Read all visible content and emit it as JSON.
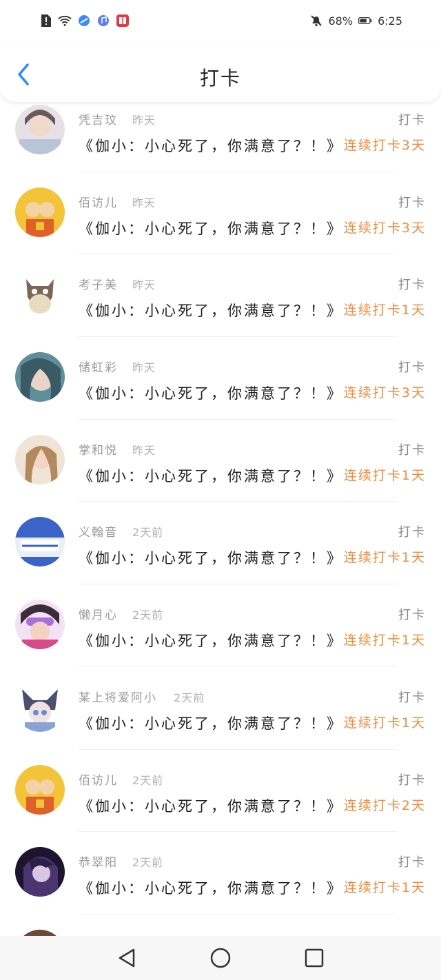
{
  "status_bar": {
    "battery_percent": "68%",
    "time": "6:25"
  },
  "header": {
    "title": "打卡"
  },
  "items": [
    {
      "name": "凭吉玟",
      "time": "昨天",
      "tag": "打卡",
      "quote": "《伽小：小心死了，你满意了？！》",
      "streak": "连续打卡3天",
      "avatar_color": "#d9d2d8"
    },
    {
      "name": "佰访儿",
      "time": "昨天",
      "tag": "打卡",
      "quote": "《伽小：小心死了，你满意了？！》",
      "streak": "连续打卡3天",
      "avatar_color": "#f3c43a"
    },
    {
      "name": "考子美",
      "time": "昨天",
      "tag": "打卡",
      "quote": "《伽小：小心死了，你满意了？！》",
      "streak": "连续打卡1天",
      "avatar_color": "#7b6657"
    },
    {
      "name": "储虹彩",
      "time": "昨天",
      "tag": "打卡",
      "quote": "《伽小：小心死了，你满意了？！》",
      "streak": "连续打卡3天",
      "avatar_color": "#5f8e9b"
    },
    {
      "name": "掌和悦",
      "time": "昨天",
      "tag": "打卡",
      "quote": "《伽小：小心死了，你满意了？！》",
      "streak": "连续打卡1天",
      "avatar_color": "#c9a884"
    },
    {
      "name": "义翰音",
      "time": "2天前",
      "tag": "打卡",
      "quote": "《伽小：小心死了，你满意了？！》",
      "streak": "连续打卡1天",
      "avatar_color": "#5a7ac8"
    },
    {
      "name": "懒月心",
      "time": "2天前",
      "tag": "打卡",
      "quote": "《伽小：小心死了，你满意了？！》",
      "streak": "连续打卡1天",
      "avatar_color": "#b45ab8"
    },
    {
      "name": "某上将爱阿小",
      "time": "2天前",
      "tag": "打卡",
      "quote": "《伽小：小心死了，你满意了？！》",
      "streak": "连续打卡1天",
      "avatar_color": "#8aa3d6"
    },
    {
      "name": "佰访儿",
      "time": "2天前",
      "tag": "打卡",
      "quote": "《伽小：小心死了，你满意了？！》",
      "streak": "连续打卡2天",
      "avatar_color": "#f3c43a"
    },
    {
      "name": "恭翠阳",
      "time": "2天前",
      "tag": "打卡",
      "quote": "《伽小：小心死了，你满意了？！》",
      "streak": "连续打卡1天",
      "avatar_color": "#3a2c54"
    }
  ],
  "colors": {
    "accent": "#2e8bff",
    "streak": "#f08a3a"
  }
}
